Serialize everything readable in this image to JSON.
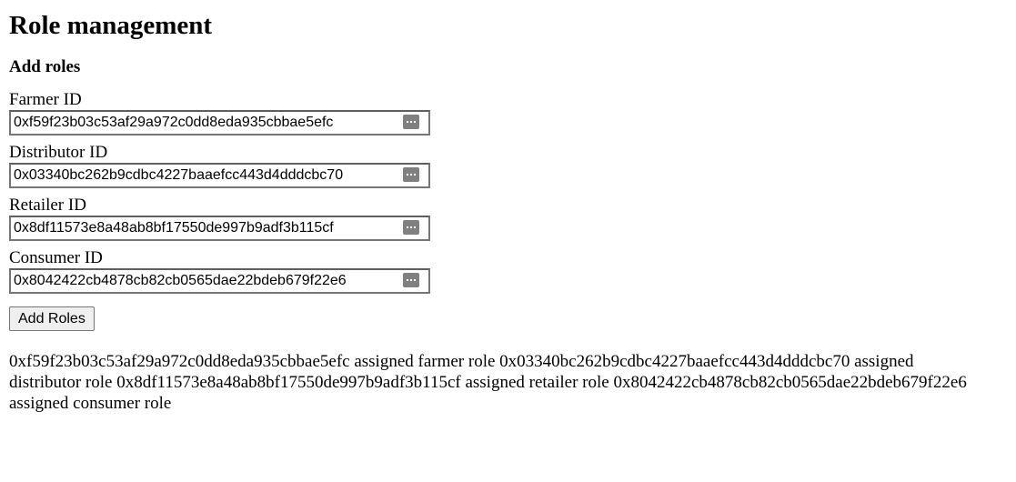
{
  "page": {
    "title": "Role management",
    "subtitle": "Add roles"
  },
  "form": {
    "fields": [
      {
        "label": "Farmer ID",
        "value": "0xf59f23b03c53af29a972c0dd8eda935cbbae5efc",
        "icon": "password-manager-icon"
      },
      {
        "label": "Distributor ID",
        "value": "0x03340bc262b9cdbc4227baaefcc443d4dddcbc70",
        "icon": "password-manager-icon"
      },
      {
        "label": "Retailer ID",
        "value": "0x8df11573e8a48ab8bf17550de997b9adf3b115cf",
        "icon": "password-manager-icon"
      },
      {
        "label": "Consumer ID",
        "value": "0x8042422cb4878cb82cb0565dae22bdeb679f22e6",
        "icon": "password-manager-icon"
      }
    ],
    "submit_label": "Add Roles"
  },
  "result": {
    "text": "0xf59f23b03c53af29a972c0dd8eda935cbbae5efc assigned farmer role 0x03340bc262b9cdbc4227baaefcc443d4dddcbc70 assigned distributor role 0x8df11573e8a48ab8bf17550de997b9adf3b115cf assigned retailer role 0x8042422cb4878cb82cb0565dae22bdeb679f22e6 assigned consumer role"
  }
}
